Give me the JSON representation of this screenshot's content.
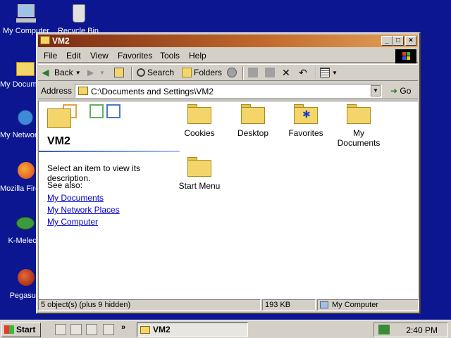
{
  "desktop": {
    "icons": [
      {
        "label": "My Computer",
        "icon": "my-computer-icon"
      },
      {
        "label": "Recycle Bin",
        "icon": "recycle-bin-icon"
      },
      {
        "label": "My Documents",
        "icon": "my-documents-icon"
      },
      {
        "label": "My Network Places",
        "icon": "network-places-icon"
      },
      {
        "label": "Mozilla Firefox",
        "icon": "firefox-icon"
      },
      {
        "label": "K-Meleon",
        "icon": "k-meleon-icon"
      },
      {
        "label": "Pegasus",
        "icon": "pegasus-icon"
      }
    ]
  },
  "window": {
    "title": "VM2",
    "menu": [
      "File",
      "Edit",
      "View",
      "Favorites",
      "Tools",
      "Help"
    ],
    "toolbar": {
      "back": "Back",
      "search": "Search",
      "folders": "Folders"
    },
    "address": {
      "label": "Address",
      "value": "C:\\Documents and Settings\\VM2",
      "go": "Go"
    },
    "left_pane": {
      "title": "VM2",
      "description": "Select an item to view its description.",
      "see_also": "See also:",
      "links": [
        "My Documents",
        "My Network Places",
        "My Computer"
      ]
    },
    "folders": [
      "Cookies",
      "Desktop",
      "Favorites",
      "My Documents",
      "Start Menu"
    ],
    "status": {
      "objects": "5 object(s) (plus 9 hidden)",
      "size": "193 KB",
      "zone": "My Computer"
    }
  },
  "taskbar": {
    "start": "Start",
    "task": "VM2",
    "clock": "2:40 PM"
  }
}
